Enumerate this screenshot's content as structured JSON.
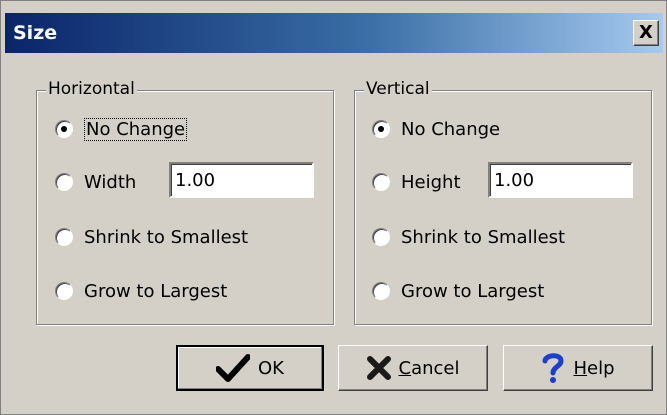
{
  "dialog": {
    "title": "Size",
    "close_glyph": "X"
  },
  "horizontal": {
    "legend": "Horizontal",
    "options": [
      "No Change",
      "Width",
      "Shrink to Smallest",
      "Grow to Largest"
    ],
    "selected": "No Change",
    "width_value": "1.00"
  },
  "vertical": {
    "legend": "Vertical",
    "options": [
      "No Change",
      "Height",
      "Shrink to Smallest",
      "Grow to Largest"
    ],
    "selected": "No Change",
    "height_value": "1.00"
  },
  "buttons": {
    "ok": {
      "icon": "checkmark-icon",
      "label": "OK"
    },
    "cancel": {
      "icon": "x-icon",
      "label_accel": "C",
      "label_rest": "ancel"
    },
    "help": {
      "icon": "question-icon",
      "label_accel": "H",
      "label_rest": "elp"
    }
  },
  "colors": {
    "dialog_bg": "#d4d0c8",
    "title_gradient_start": "#0a246a",
    "title_gradient_end": "#a6caf0",
    "help_icon": "#1a3fd0",
    "cancel_icon": "#1a1a1a"
  }
}
